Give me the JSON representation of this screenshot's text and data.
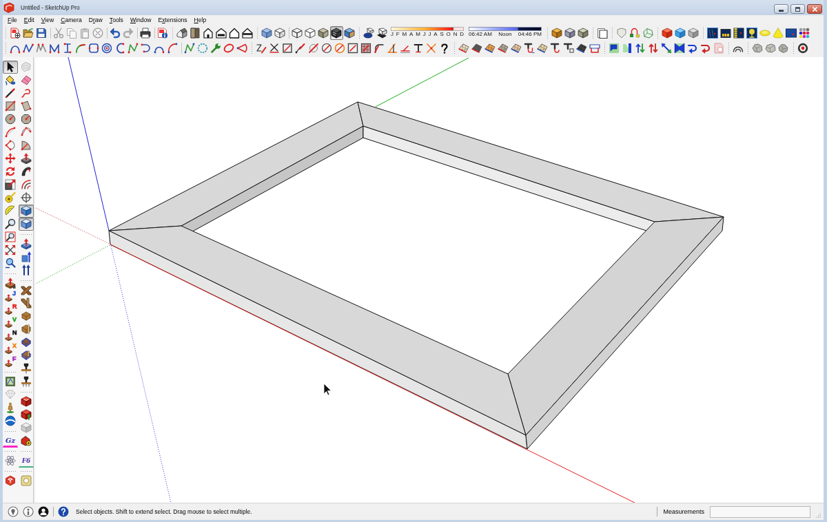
{
  "window": {
    "title": "Untitled - SketchUp Pro"
  },
  "menu": [
    {
      "key": "F",
      "post": "ile"
    },
    {
      "key": "E",
      "post": "dit"
    },
    {
      "key": "V",
      "post": "iew"
    },
    {
      "key": "C",
      "post": "amera"
    },
    {
      "pre": "D",
      "key": "r",
      "post": "aw"
    },
    {
      "key": "T",
      "post": "ools"
    },
    {
      "key": "W",
      "post": "indow"
    },
    {
      "pre": "E",
      "key": "x",
      "post": "tensions"
    },
    {
      "key": "H",
      "post": "elp"
    }
  ],
  "toolbars_row_1": [
    {
      "buttons": [
        {
          "disabled": false
        },
        {
          "disabled": false
        },
        {
          "disabled": false
        },
        {
          "disabled": true
        },
        {
          "disabled": true
        },
        {
          "disabled": true
        },
        {
          "disabled": true
        },
        {
          "disabled": false
        },
        {
          "disabled": true
        },
        {
          "disabled": false
        },
        {
          "disabled": false
        }
      ]
    },
    {
      "buttons": [
        {
          "selected": false
        },
        {
          "selected": false
        },
        {
          "selected": false
        },
        {
          "selected": false
        },
        {
          "selected": false
        },
        {
          "selected": false
        }
      ]
    },
    {
      "buttons": [
        {
          "selected": false
        },
        {
          "selected": false
        },
        {
          "selected": false
        },
        {
          "selected": false
        },
        {
          "selected": false
        },
        {
          "selected": true
        },
        {
          "selected": false
        }
      ]
    },
    {
      "buttons": [
        {
          "selected": false
        },
        {
          "selected": false
        }
      ],
      "date_slider": {
        "months": [
          "J",
          "F",
          "M",
          "A",
          "M",
          "J",
          "J",
          "A",
          "S",
          "O",
          "N",
          "D"
        ],
        "level": 0.87
      },
      "time_slider": {
        "labels": [
          "06:42 AM",
          "Noon",
          "04:46 PM"
        ],
        "level": 0.68
      }
    },
    {
      "buttons": [
        {
          "selected": false
        },
        {
          "selected": false
        },
        {
          "selected": false
        }
      ]
    },
    {
      "buttons": [
        {
          "selected": false
        }
      ]
    },
    {
      "buttons": [
        {
          "selected": false
        },
        {
          "selected": false
        },
        {
          "selected": false
        }
      ]
    },
    {
      "buttons": [
        {
          "selected": false
        },
        {
          "selected": false
        },
        {
          "selected": false
        }
      ]
    },
    {
      "buttons": [
        {
          "selected": false
        },
        {
          "selected": false
        },
        {
          "selected": false
        },
        {
          "selected": false
        },
        {
          "selected": false
        },
        {
          "selected": false
        },
        {
          "selected": false
        },
        {
          "selected": false
        }
      ]
    }
  ],
  "toolbars_row_2": [
    {
      "buttons": [
        {
          "selected": false
        },
        {
          "selected": false
        },
        {
          "selected": false
        },
        {
          "selected": false
        },
        {
          "selected": false
        },
        {
          "selected": false
        },
        {
          "selected": false
        },
        {
          "selected": false
        },
        {
          "selected": false
        },
        {
          "selected": false
        },
        {
          "selected": false
        },
        {
          "selected": false
        },
        {
          "selected": false
        },
        {
          "selected": false
        },
        {
          "selected": false
        },
        {
          "selected": false
        },
        {
          "selected": false
        },
        {
          "selected": false
        }
      ]
    },
    {
      "buttons": [
        {
          "selected": false
        },
        {
          "selected": false
        },
        {
          "selected": false
        },
        {
          "selected": false
        },
        {
          "selected": false
        },
        {
          "selected": false
        },
        {
          "selected": false
        },
        {
          "selected": false
        },
        {
          "selected": false
        },
        {
          "selected": false
        },
        {
          "selected": false
        },
        {
          "selected": false
        },
        {
          "selected": false
        },
        {
          "selected": false
        },
        {
          "selected": false
        }
      ]
    },
    {
      "buttons": [
        {
          "selected": false
        },
        {
          "selected": false
        },
        {
          "selected": false
        },
        {
          "selected": false
        },
        {
          "selected": false
        },
        {
          "selected": false
        },
        {
          "selected": false
        },
        {
          "selected": false
        },
        {
          "selected": false
        },
        {
          "selected": false
        },
        {
          "selected": false
        }
      ]
    },
    {
      "buttons": [
        {
          "selected": false
        },
        {
          "selected": false
        },
        {
          "selected": false
        },
        {
          "selected": false
        },
        {
          "selected": false
        },
        {
          "selected": false
        },
        {
          "selected": false
        },
        {
          "selected": false
        },
        {
          "selected": false
        }
      ]
    },
    {
      "buttons": [
        {
          "selected": false
        }
      ]
    },
    {
      "buttons": [
        {
          "selected": false
        },
        {
          "selected": false
        },
        {
          "selected": false
        }
      ]
    },
    {
      "buttons": [
        {
          "selected": false
        }
      ]
    }
  ],
  "left_toolbars": [
    {
      "toolbars": [
        {
          "buttons": [
            {
              "selected": true
            },
            {
              "selected": false
            },
            {
              "selected": false
            },
            {
              "selected": false
            },
            {
              "selected": false
            },
            {
              "selected": false
            },
            {
              "selected": false
            },
            {
              "selected": false
            },
            {
              "selected": false
            },
            {
              "selected": false
            },
            {
              "selected": false
            },
            {
              "selected": false
            },
            {
              "selected": false
            },
            {
              "selected": false
            },
            {
              "selected": false
            },
            {
              "selected": false
            }
          ]
        },
        {
          "buttons": [
            {
              "selected": false
            },
            {
              "selected": false,
              "letter": "J",
              "color": "#2050d0"
            },
            {
              "selected": false,
              "letter": "R",
              "color": "#e02020"
            },
            {
              "selected": false,
              "letter": "V",
              "color": "#20a020"
            },
            {
              "selected": false,
              "letter": "N",
              "color": "#111111"
            },
            {
              "selected": false,
              "letter": "X",
              "color": "#f08010"
            },
            {
              "selected": false,
              "letter": "F",
              "color": "#a020c0"
            }
          ]
        },
        {
          "buttons": [
            {
              "selected": false
            },
            {
              "selected": false
            },
            {
              "selected": false
            },
            {
              "selected": false
            }
          ]
        },
        {
          "buttons": [
            {
              "selected": false,
              "text": "Gz"
            }
          ]
        },
        {
          "buttons": [
            {
              "selected": false
            }
          ]
        },
        {
          "buttons": [
            {
              "selected": false
            }
          ]
        }
      ]
    },
    {
      "toolbars": [
        {
          "buttons": [
            {
              "selected": false
            },
            {
              "selected": false
            },
            {
              "selected": false
            },
            {
              "selected": false
            },
            {
              "selected": false
            },
            {
              "selected": false
            },
            {
              "selected": false
            },
            {
              "selected": false
            },
            {
              "selected": false
            },
            {
              "selected": false
            },
            {
              "selected": false
            },
            {
              "selected": true
            },
            {
              "selected": true
            }
          ]
        },
        {
          "buttons": [
            {
              "selected": false
            },
            {
              "selected": false
            },
            {
              "selected": false
            }
          ]
        },
        {
          "buttons": [
            {
              "selected": false
            },
            {
              "selected": false
            },
            {
              "selected": false
            },
            {
              "selected": false
            },
            {
              "selected": false
            },
            {
              "selected": false
            },
            {
              "selected": false
            },
            {
              "selected": false
            }
          ]
        },
        {
          "buttons": [
            {
              "selected": false
            },
            {
              "selected": false
            },
            {
              "selected": false
            },
            {
              "selected": false
            }
          ]
        },
        {
          "buttons": [
            {
              "selected": false,
              "text": "F6"
            }
          ]
        },
        {
          "buttons": [
            {
              "selected": false
            }
          ]
        }
      ]
    }
  ],
  "status_bar": {
    "hint": "Select objects. Shift to extend select. Drag mouse to select multiple.",
    "measurements_label": "Measurements"
  }
}
